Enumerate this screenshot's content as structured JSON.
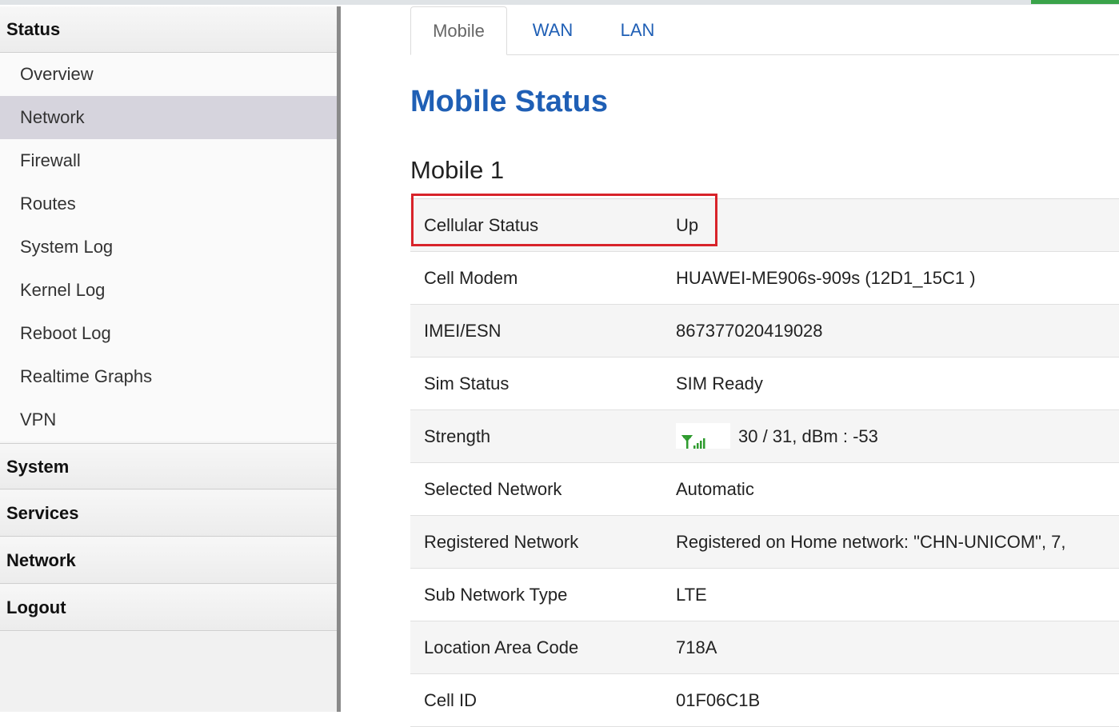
{
  "sidebar": {
    "status_header": "Status",
    "items": [
      {
        "label": "Overview"
      },
      {
        "label": "Network"
      },
      {
        "label": "Firewall"
      },
      {
        "label": "Routes"
      },
      {
        "label": "System Log"
      },
      {
        "label": "Kernel Log"
      },
      {
        "label": "Reboot Log"
      },
      {
        "label": "Realtime Graphs"
      },
      {
        "label": "VPN"
      }
    ],
    "sections": [
      {
        "label": "System"
      },
      {
        "label": "Services"
      },
      {
        "label": "Network"
      },
      {
        "label": "Logout"
      }
    ]
  },
  "tabs": [
    {
      "label": "Mobile"
    },
    {
      "label": "WAN"
    },
    {
      "label": "LAN"
    }
  ],
  "main": {
    "title": "Mobile Status",
    "section": "Mobile 1",
    "rows": [
      {
        "label": "Cellular Status",
        "value": "Up"
      },
      {
        "label": "Cell Modem",
        "value": "HUAWEI-ME906s-909s (12D1_15C1 )"
      },
      {
        "label": "IMEI/ESN",
        "value": "867377020419028"
      },
      {
        "label": "Sim Status",
        "value": "SIM Ready"
      },
      {
        "label": "Strength",
        "value": "30 / 31, dBm : -53"
      },
      {
        "label": "Selected Network",
        "value": "Automatic"
      },
      {
        "label": "Registered Network",
        "value": "Registered on Home network: \"CHN-UNICOM\", 7,"
      },
      {
        "label": "Sub Network Type",
        "value": "LTE"
      },
      {
        "label": "Location Area Code",
        "value": "718A"
      },
      {
        "label": "Cell ID",
        "value": "01F06C1B"
      }
    ],
    "signal_icon": "signal-strength-icon",
    "signal_color": "#2e9b2e",
    "highlight_color": "#d8232a"
  }
}
